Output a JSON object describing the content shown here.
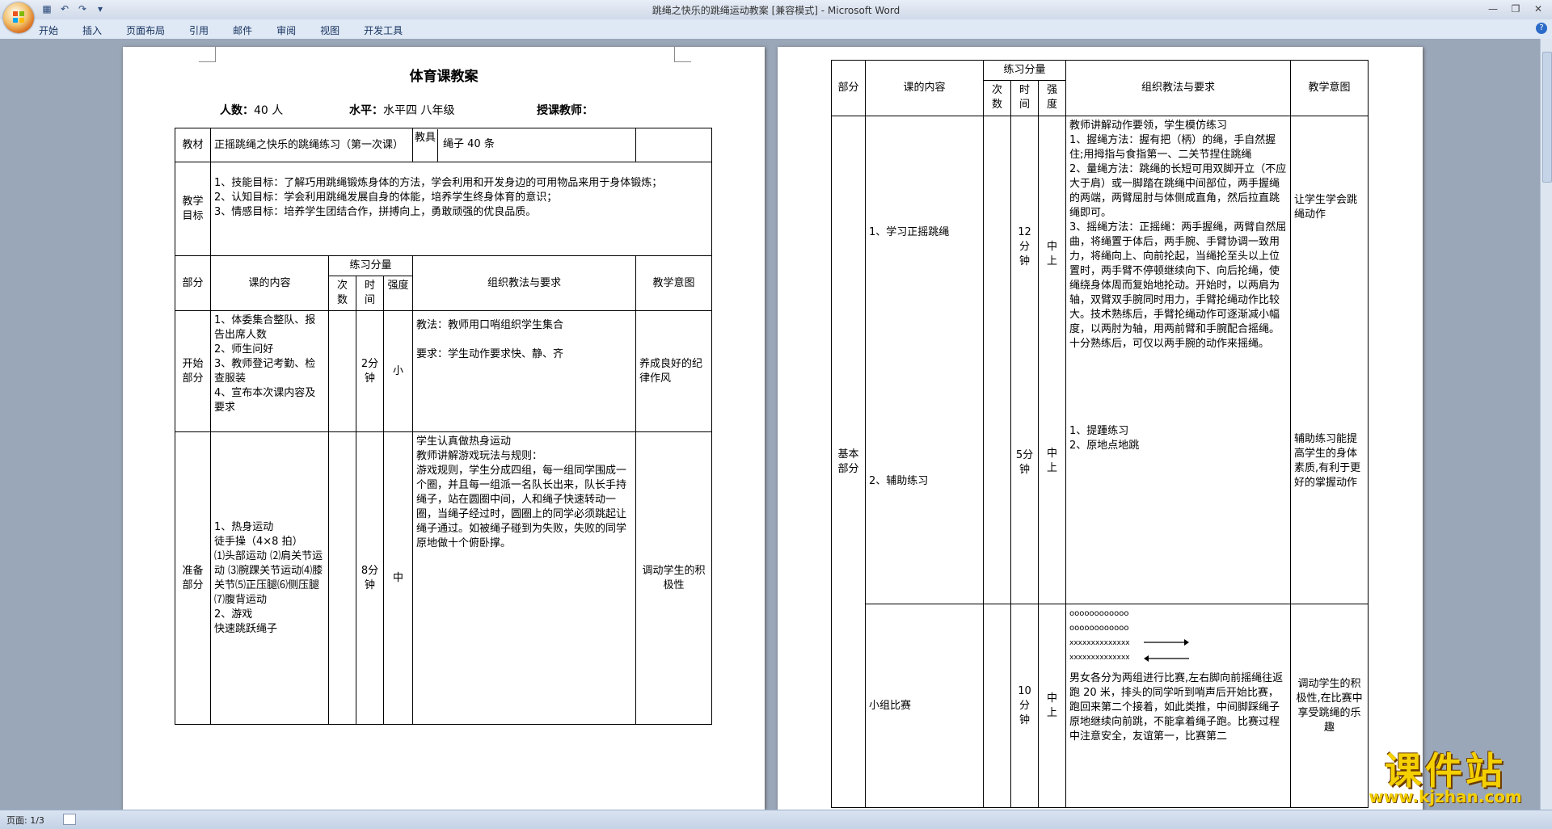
{
  "window": {
    "title": "跳绳之快乐的跳绳运动教案 [兼容模式] - Microsoft Word",
    "tabs": [
      "开始",
      "插入",
      "页面布局",
      "引用",
      "邮件",
      "审阅",
      "视图",
      "开发工具"
    ],
    "status_page": "页面: 1/3"
  },
  "page1": {
    "title": "体育课教案",
    "count_label": "人数：",
    "count_value": "40 人",
    "level_label": "水平：",
    "level_value": "水平四  八年级",
    "teacher_label": "授课教师：",
    "material_label": "教材",
    "material_value": "正摇跳绳之快乐的跳绳练习（第一次课）",
    "equipment_label": "教具",
    "equipment_value": "绳子 40 条",
    "goals_label": "教学目标",
    "goals": [
      "1、技能目标：了解巧用跳绳锻炼身体的方法，学会利用和开发身边的可用物品来用于身体锻炼；",
      "2、认知目标：学会利用跳绳发展自身的体能，培养学生终身体育的意识；",
      "3、情感目标：培养学生团结合作，拼搏向上，勇敢顽强的优良品质。"
    ],
    "header": {
      "part": "部分",
      "content": "课的内容",
      "load": "练习分量",
      "times": "次数",
      "time": "时间",
      "intensity": "强度",
      "method": "组织教法与要求",
      "intent": "教学意图"
    },
    "start": {
      "part": "开始部分",
      "content": [
        "1、体委集合整队、报告出席人数",
        "2、师生问好",
        "3、教师登记考勤、检查服装",
        "4、宣布本次课内容及要求"
      ],
      "time": "2分钟",
      "intensity": "小",
      "method1": "教法：教师用口哨组织学生集合",
      "method2": "要求：学生动作要求快、静、齐",
      "intent": "养成良好的纪律作风"
    },
    "prep": {
      "part": "准备部分",
      "content": [
        "1、热身运动",
        "徒手操（4×8 拍）",
        "⑴头部运动 ⑵肩关节运动 ⑶腕踝关节运动⑷膝关节⑸正压腿⑹侧压腿⑺腹背运动",
        "2、游戏",
        "快速跳跃绳子"
      ],
      "time": "8分钟",
      "intensity": "中",
      "method": [
        "学生认真做热身运动",
        "教师讲解游戏玩法与规则：",
        "游戏规则，学生分成四组，每一组同学围成一个圈，并且每一组派一名队长出来，队长手持绳子，站在圆圈中间，人和绳子快速转动一圈，当绳子经过时，圆圈上的同学必须跳起让绳子通过。如被绳子碰到为失败，失败的同学原地做十个俯卧撑。"
      ],
      "intent": "调动学生的积极性"
    }
  },
  "page2": {
    "header": {
      "part": "部分",
      "content": "课的内容",
      "load": "练习分量",
      "times": "次数",
      "time": "时间",
      "intensity": "强度",
      "method": "组织教法与要求",
      "intent": "教学意图"
    },
    "basic_part": "基本部分",
    "row1": {
      "content1": "1、学习正摇跳绳",
      "content2": "2、辅助练习",
      "time1": "12分钟",
      "intensity1": "中上",
      "time2": "5分钟",
      "intensity2": "中上",
      "method": [
        "教师讲解动作要领，学生模仿练习",
        "1、握绳方法：握有把（柄）的绳，手自然握住;用拇指与食指第一、二关节捏住跳绳",
        "2、量绳方法：跳绳的长短可用双脚开立（不应大于肩）或一脚踏在跳绳中间部位，两手握绳的两端，两臂屈肘与体侧成直角，然后拉直跳绳即可。",
        "3、摇绳方法：正摇绳：两手握绳，两臂自然屈曲，将绳置于体后，两手腕、手臂协调一致用力，将绳向上、向前抡起，当绳抡至头以上位置时，两手臂不停顿继续向下、向后抡绳，使绳绕身体周而复始地抡动。开始时，以两肩为轴，双臂双手腕同时用力，手臂抡绳动作比较大。技术熟练后，手臂抡绳动作可逐渐减小幅度，以两肘为轴，用两前臂和手腕配合摇绳。十分熟练后，可仅以两手腕的动作来摇绳。"
      ],
      "aux": [
        "1、提踵练习",
        "2、原地点地跳"
      ],
      "intent1": "让学生学会跳绳动作",
      "intent2": "辅助练习能提高学生的身体素质,有利于更好的掌握动作"
    },
    "row2": {
      "content": "小组比赛",
      "time": "10分钟",
      "intensity": "中上",
      "diagram": [
        "oooooooooooo",
        "oooooooooooo",
        "xxxxxxxxxxxxxx",
        "xxxxxxxxxxxxxx"
      ],
      "method": "男女各分为两组进行比赛,左右脚向前摇绳往返跑 20 米，排头的同学听到哨声后开始比赛，跑回来第二个接着，如此类推，中间脚踩绳子原地继续向前跳，不能拿着绳子跑。比赛过程中注意安全，友谊第一，比赛第二",
      "intent": "调动学生的积极性,在比赛中享受跳绳的乐趣"
    }
  },
  "watermark": {
    "name": "课件站",
    "url": "www.kjzhan.com"
  }
}
